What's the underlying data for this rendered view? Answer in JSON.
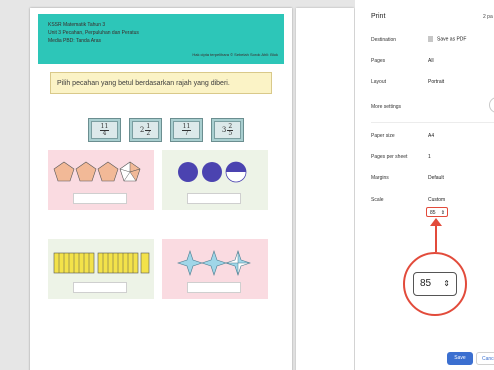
{
  "worksheet": {
    "banner_line1": "KSSR Matematik Tahun 3",
    "banner_line2": "Unit 3 Pecahan, Perpuluhan dan Peratus",
    "banner_line3": "Media PBD: Tanda Aras",
    "banner_credit": "Hak cipta terpelihara © Sebelah Sorok Ahli: Blok",
    "instruction": "Pilih pecahan yang betul berdasarkan rajah yang diberi.",
    "fractions": [
      {
        "whole": "",
        "num": "11",
        "den": "4"
      },
      {
        "whole": "2",
        "num": "1",
        "den": "2"
      },
      {
        "whole": "",
        "num": "11",
        "den": "7"
      },
      {
        "whole": "3",
        "num": "2",
        "den": "5"
      }
    ]
  },
  "print": {
    "title": "Print",
    "page_count": "2 pa",
    "rows": [
      {
        "label": "Destination",
        "value": "Save as PDF"
      },
      {
        "label": "Pages",
        "value": "All"
      },
      {
        "label": "Layout",
        "value": "Portrait"
      },
      {
        "label": "More settings",
        "value": ""
      },
      {
        "label": "Paper size",
        "value": "A4"
      },
      {
        "label": "Pages per sheet",
        "value": "1"
      },
      {
        "label": "Margins",
        "value": "Default"
      },
      {
        "label": "Scale",
        "value": "Custom"
      }
    ],
    "scale_value": "85",
    "spinner_glyph": "⇕",
    "save_label": "Save",
    "cancel_label": "Cance"
  },
  "colors": {
    "accent": "#3b6fd0",
    "highlight": "#e24b3b",
    "banner": "#2dc6b8"
  }
}
